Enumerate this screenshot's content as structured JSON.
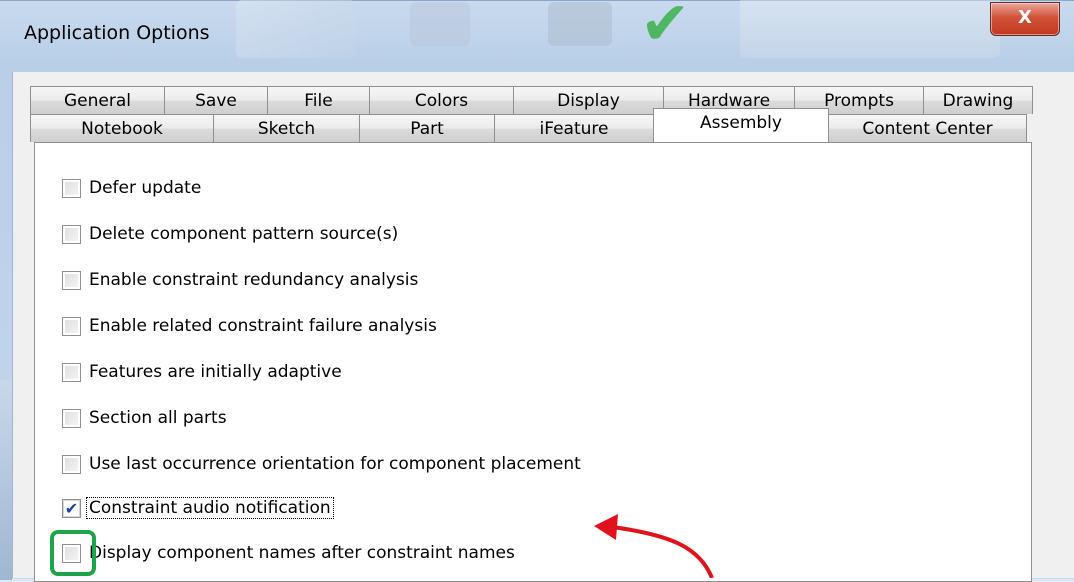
{
  "window": {
    "title": "Application Options",
    "close_label": "X"
  },
  "tabs": {
    "row1": [
      "General",
      "Save",
      "File",
      "Colors",
      "Display",
      "Hardware",
      "Prompts",
      "Drawing"
    ],
    "row2": [
      "Notebook",
      "Sketch",
      "Part",
      "iFeature",
      "Assembly",
      "Content Center"
    ],
    "selected": "Assembly"
  },
  "options": [
    {
      "label": "Defer update",
      "checked": false
    },
    {
      "label": "Delete component pattern source(s)",
      "checked": false
    },
    {
      "label": "Enable constraint redundancy analysis",
      "checked": false
    },
    {
      "label": "Enable related constraint failure analysis",
      "checked": false
    },
    {
      "label": "Features are initially adaptive",
      "checked": false
    },
    {
      "label": "Section all parts",
      "checked": false
    },
    {
      "label": "Use last occurrence orientation for component placement",
      "checked": false
    },
    {
      "label": "Constraint audio notification",
      "checked": true
    },
    {
      "label": "Display component names after constraint names",
      "checked": false
    }
  ],
  "annotation": {
    "highlight_color": "#1ea24a",
    "arrow_color": "#e0121b"
  }
}
